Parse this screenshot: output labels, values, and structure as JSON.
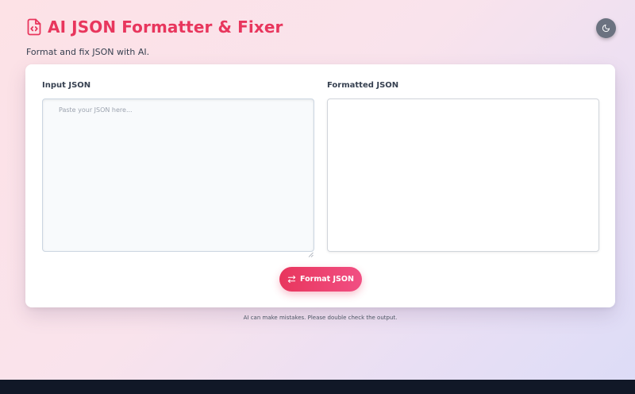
{
  "header": {
    "title": "AI JSON Formatter & Fixer",
    "subtitle": "Format and fix JSON with AI.",
    "logo_icon": "file-code-icon",
    "theme_toggle_icon": "moon-icon"
  },
  "input_panel": {
    "label": "Input JSON",
    "placeholder": "Paste your JSON here...",
    "value": ""
  },
  "output_panel": {
    "label": "Formatted JSON",
    "value": ""
  },
  "actions": {
    "format_label": "Format JSON",
    "format_icon": "swap-arrows-icon"
  },
  "disclaimer": "AI can make mistakes. Please double check the output.",
  "colors": {
    "accent": "#e8365d",
    "accent_end": "#f14f83",
    "theme_button": "#6b7280",
    "footer": "#111827"
  }
}
